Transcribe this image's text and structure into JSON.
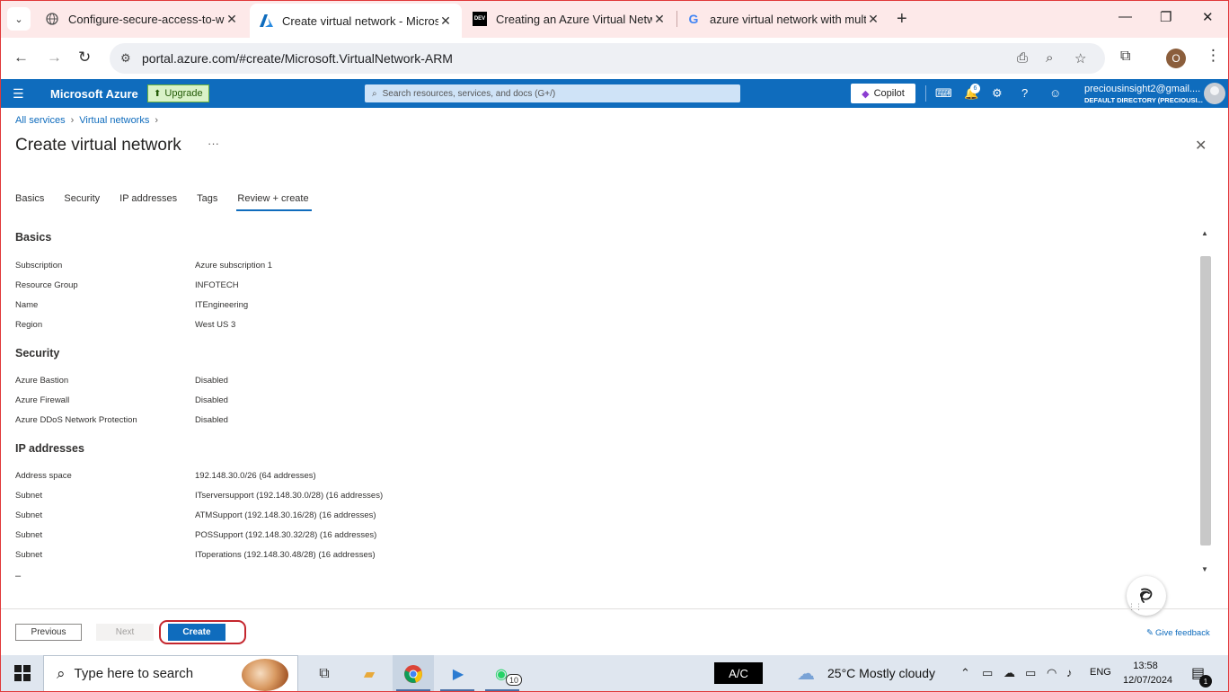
{
  "browser": {
    "tabs": [
      {
        "title": "Configure-secure-access-to-wo",
        "icon": "globe-icon"
      },
      {
        "title": "Create virtual network - Micros",
        "icon": "azure-logo-icon",
        "active": true
      },
      {
        "title": "Creating an Azure Virtual Netw",
        "icon": "dev-logo-icon",
        "icon_text": "DEV"
      },
      {
        "title": "azure virtual network with multi",
        "icon": "google-logo-icon",
        "icon_text": "G"
      }
    ],
    "url": "portal.azure.com/#create/Microsoft.VirtualNetwork-ARM",
    "profile_initial": "O"
  },
  "azure_header": {
    "brand": "Microsoft Azure",
    "upgrade_label": "Upgrade",
    "search_placeholder": "Search resources, services, and docs (G+/)",
    "copilot_label": "Copilot",
    "notification_count": "6",
    "account_name": "preciousinsight2@gmail....",
    "account_directory": "DEFAULT DIRECTORY (PRECIOUSI..."
  },
  "breadcrumb": [
    "All services",
    "Virtual networks"
  ],
  "page": {
    "title": "Create virtual network",
    "ellipsis": "···"
  },
  "tabs": [
    "Basics",
    "Security",
    "IP addresses",
    "Tags",
    "Review + create"
  ],
  "selected_tab": "Review + create",
  "sections": {
    "basics": {
      "heading": "Basics",
      "rows": [
        {
          "key": "Subscription",
          "value": "Azure subscription 1"
        },
        {
          "key": "Resource Group",
          "value": "INFOTECH"
        },
        {
          "key": "Name",
          "value": "ITEngineering"
        },
        {
          "key": "Region",
          "value": "West US 3"
        }
      ]
    },
    "security": {
      "heading": "Security",
      "rows": [
        {
          "key": "Azure Bastion",
          "value": "Disabled"
        },
        {
          "key": "Azure Firewall",
          "value": "Disabled"
        },
        {
          "key": "Azure DDoS Network Protection",
          "value": "Disabled"
        }
      ]
    },
    "ip": {
      "heading": "IP addresses",
      "rows": [
        {
          "key": "Address space",
          "value": "192.148.30.0/26 (64 addresses)"
        },
        {
          "key": "Subnet",
          "value": "ITserversupport (192.148.30.0/28) (16 addresses)"
        },
        {
          "key": "Subnet",
          "value": "ATMSupport (192.148.30.16/28) (16 addresses)"
        },
        {
          "key": "Subnet",
          "value": "POSSupport (192.148.30.32/28) (16 addresses)"
        },
        {
          "key": "Subnet",
          "value": "IToperations (192.148.30.48/28) (16 addresses)"
        }
      ]
    },
    "trailing_mark": "–"
  },
  "footer": {
    "previous": "Previous",
    "next": "Next",
    "create": "Create",
    "feedback": "Give feedback"
  },
  "taskbar": {
    "search_placeholder": "Type here to search",
    "whatsapp_badge": "10",
    "ac_label": "A/C",
    "weather": "25°C  Mostly cloudy",
    "language": "ENG",
    "time": "13:58",
    "date": "12/07/2024",
    "notification_badge": "1"
  },
  "colors": {
    "azure_blue": "#0f6cbd",
    "highlight_red": "#c4262e",
    "tabstrip": "#fde9e9"
  }
}
